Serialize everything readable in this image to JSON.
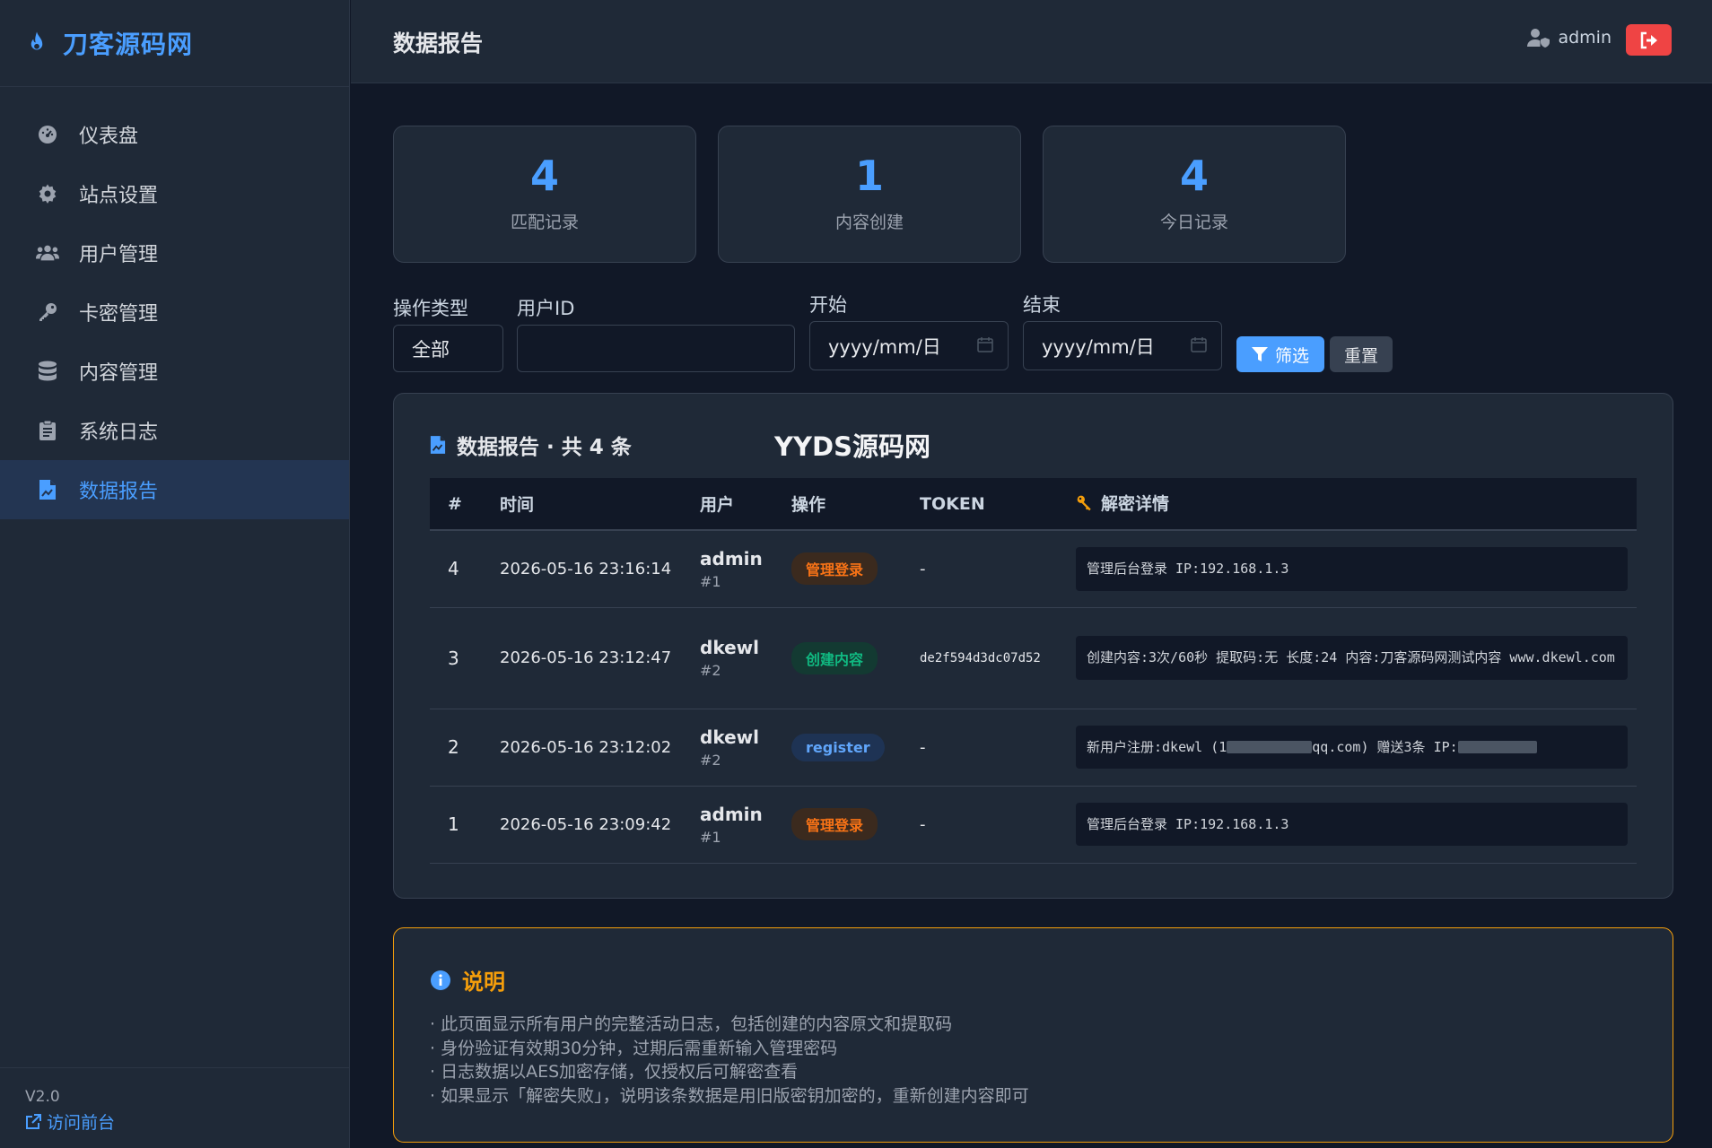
{
  "brand": {
    "name": "刀客源码网"
  },
  "nav": [
    {
      "label": "仪表盘",
      "icon": "dashboard-icon"
    },
    {
      "label": "站点设置",
      "icon": "gear-icon"
    },
    {
      "label": "用户管理",
      "icon": "users-icon"
    },
    {
      "label": "卡密管理",
      "icon": "key-icon"
    },
    {
      "label": "内容管理",
      "icon": "database-icon"
    },
    {
      "label": "系统日志",
      "icon": "clipboard-icon"
    },
    {
      "label": "数据报告",
      "icon": "file-chart-icon",
      "active": true
    }
  ],
  "footer": {
    "version": "V2.0",
    "visit_label": "访问前台"
  },
  "header": {
    "title": "数据报告",
    "user": "admin"
  },
  "stats": [
    {
      "value": "4",
      "label": "匹配记录"
    },
    {
      "value": "1",
      "label": "内容创建"
    },
    {
      "value": "4",
      "label": "今日记录"
    }
  ],
  "filters": {
    "type_label": "操作类型",
    "type_value": "全部",
    "userid_label": "用户ID",
    "userid_value": "",
    "start_label": "开始",
    "start_placeholder": "yyyy/mm/日",
    "end_label": "结束",
    "end_placeholder": "yyyy/mm/日",
    "filter_button": "筛选",
    "reset_button": "重置"
  },
  "report": {
    "title": "数据报告 · 共 4 条",
    "watermark": "YYDS源码网",
    "columns": [
      "#",
      "时间",
      "用户",
      "操作",
      "TOKEN",
      "解密详情"
    ],
    "rows": [
      {
        "id": "4",
        "time": "2026-05-16 23:16:14",
        "user": "admin",
        "uid": "#1",
        "action": "管理登录",
        "action_color": "#f97316",
        "action_bg": "#3b2a1e",
        "token": "-",
        "detail": "管理后台登录 IP:192.168.1.3"
      },
      {
        "id": "3",
        "time": "2026-05-16 23:12:47",
        "user": "dkewl",
        "uid": "#2",
        "action": "创建内容",
        "action_color": "#10b981",
        "action_bg": "#133a32",
        "token": "de2f594d3dc07d52",
        "detail": "创建内容:3次/60秒 提取码:无 长度:24 内容:刀客源码网测试内容  www.dkewl.com"
      },
      {
        "id": "2",
        "time": "2026-05-16 23:12:02",
        "user": "dkewl",
        "uid": "#2",
        "action": "register",
        "action_color": "#60a5fa",
        "action_bg": "#1e3354",
        "token": "-",
        "detail_a": "新用户注册:dkewl (1",
        "detail_b": "qq.com) 赠送3条 IP:"
      },
      {
        "id": "1",
        "time": "2026-05-16 23:09:42",
        "user": "admin",
        "uid": "#1",
        "action": "管理登录",
        "action_color": "#f97316",
        "action_bg": "#3b2a1e",
        "token": "-",
        "detail": "管理后台登录 IP:192.168.1.3"
      }
    ]
  },
  "notice": {
    "title": "说明",
    "lines": [
      "· 此页面显示所有用户的完整活动日志，包括创建的内容原文和提取码",
      "· 身份验证有效期30分钟，过期后需重新输入管理密码",
      "· 日志数据以AES加密存储，仅授权后可解密查看",
      "· 如果显示「解密失败」，说明该条数据是用旧版密钥加密的，重新创建内容即可"
    ]
  },
  "colors": {
    "accent": "#4a9eff",
    "danger": "#ef4444",
    "warning": "#f59e0b"
  }
}
